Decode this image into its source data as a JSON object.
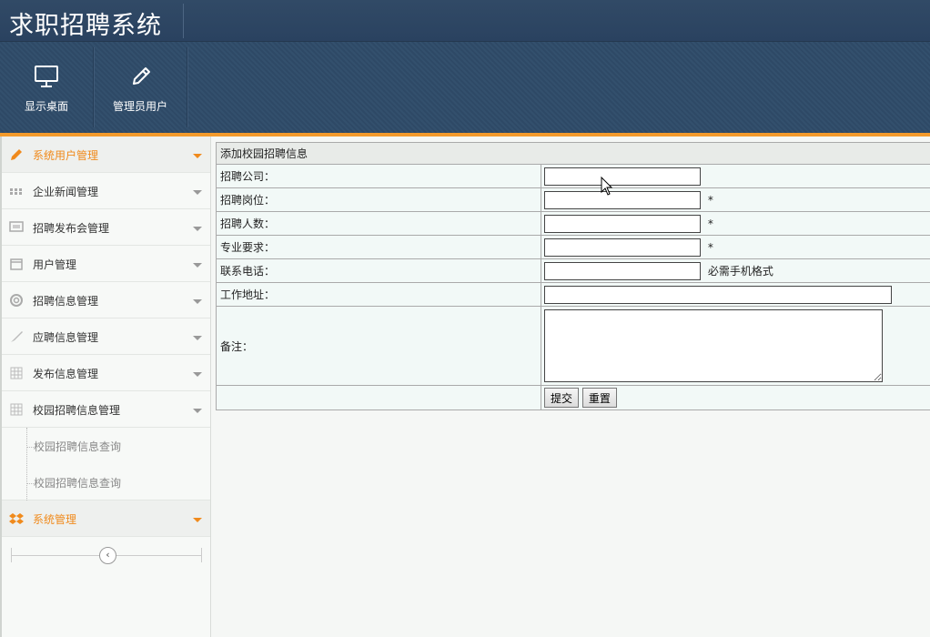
{
  "app": {
    "title": "求职招聘系统"
  },
  "toolbar": {
    "buttons": [
      {
        "label": "显示桌面",
        "icon": "monitor-icon"
      },
      {
        "label": "管理员用户",
        "icon": "pencil-icon"
      }
    ]
  },
  "sidebar": {
    "items": [
      {
        "label": "系统用户管理",
        "icon": "pencil-icon"
      },
      {
        "label": "企业新闻管理",
        "icon": "grid-dots-icon"
      },
      {
        "label": "招聘发布会管理",
        "icon": "screen-icon"
      },
      {
        "label": "用户管理",
        "icon": "calendar-icon"
      },
      {
        "label": "招聘信息管理",
        "icon": "lifebuoy-icon"
      },
      {
        "label": "应聘信息管理",
        "icon": "brush-icon"
      },
      {
        "label": "发布信息管理",
        "icon": "table-grid-icon"
      },
      {
        "label": "校园招聘信息管理",
        "icon": "table-grid-icon"
      }
    ],
    "sub_items": [
      {
        "label": "校园招聘信息查询"
      },
      {
        "label": "校园招聘信息查询"
      }
    ],
    "system": {
      "label": "系统管理",
      "icon": "dropbox-icon"
    },
    "collapse_glyph": "‹",
    "accent_color": "#f08a1c"
  },
  "form": {
    "caption": "添加校园招聘信息",
    "fields": [
      {
        "label": "招聘公司：",
        "value": "",
        "note": ""
      },
      {
        "label": "招聘岗位：",
        "value": "",
        "note": "*"
      },
      {
        "label": "招聘人数：",
        "value": "",
        "note": "*"
      },
      {
        "label": "专业要求：",
        "value": "",
        "note": "*"
      },
      {
        "label": "联系电话：",
        "value": "",
        "note": "必需手机格式"
      },
      {
        "label": "工作地址：",
        "value": "",
        "note": ""
      }
    ],
    "remark_label": "备注：",
    "remark_value": "",
    "submit_label": "提交",
    "reset_label": "重置"
  }
}
